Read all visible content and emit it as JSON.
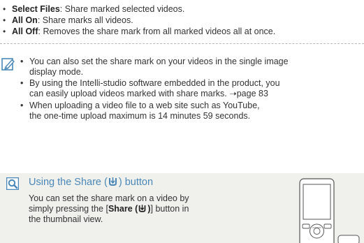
{
  "options": [
    {
      "term": "Select Files",
      "desc": ": Share marked selected videos."
    },
    {
      "term": "All On",
      "desc": ": Share marks all videos."
    },
    {
      "term": "All Off",
      "desc": ": Removes the share mark from all marked videos all at once."
    }
  ],
  "notes": [
    {
      "lines": [
        "You can also set the share mark on your videos in the single image",
        "display mode."
      ]
    },
    {
      "lines": [
        "By using the Intelli-studio software embedded in the product, you",
        "can easily upload videos marked with share marks. ➝page 83"
      ]
    },
    {
      "lines": [
        "When uploading a video file to a web site such as YouTube,",
        "the one-time upload maximum is 14 minutes 59 seconds."
      ]
    }
  ],
  "tip": {
    "title_prefix": "Using the Share (",
    "title_suffix": ") button",
    "line1": "You can set the share mark on a video by",
    "line2_prefix": "simply pressing the [",
    "line2_bold": "Share",
    "line2_bold_open": " (",
    "line2_bold_close": ")",
    "line2_suffix": "] button in",
    "line3": "the thumbnail view."
  },
  "colors": {
    "tip_title": "#4a88b9",
    "tip_background": "#f0f0ec",
    "icon_blue": "#4a88b9"
  },
  "icons": {
    "note": "pencil-note-icon",
    "tip": "magnifier-icon",
    "share": "share-icon"
  }
}
